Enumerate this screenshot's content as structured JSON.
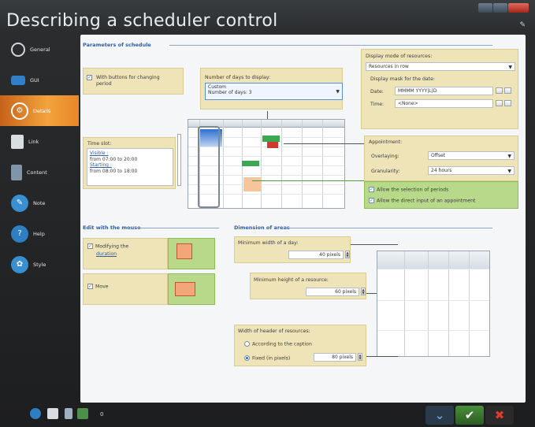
{
  "window": {
    "title": "Describing a scheduler control"
  },
  "sidebar": {
    "items": [
      {
        "label": "General",
        "icon": "circle-icon",
        "active": false
      },
      {
        "label": "GUI",
        "icon": "gui-icon",
        "active": false
      },
      {
        "label": "Details",
        "icon": "details-icon",
        "active": true
      },
      {
        "label": "Link",
        "icon": "link-icon",
        "active": false
      },
      {
        "label": "Content",
        "icon": "content-icon",
        "active": false
      },
      {
        "label": "Note",
        "icon": "note-icon",
        "active": false
      },
      {
        "label": "Help",
        "icon": "help-icon",
        "active": false
      },
      {
        "label": "Style",
        "icon": "style-icon",
        "active": false
      }
    ]
  },
  "params": {
    "section_title": "Parameters of schedule",
    "with_buttons_label": "With buttons for changing period",
    "days_label": "Number of days to display:",
    "days_value_line1": "Custom",
    "days_value_line2": "Number of days: 3",
    "time_slot_label": "Time slot:",
    "visible_label": "Visible :",
    "visible_value": "from 07:00 to 20:00",
    "starting_label": "Starting :",
    "starting_value": "from 08:00 to 18:00"
  },
  "display_mode": {
    "label": "Display mode of resources:",
    "value": "Resources in row",
    "mask_label": "Display mask for the date:",
    "date_label": "Date:",
    "date_value": "MMMM YYYY|L|D",
    "time_label": "Time:",
    "time_value": "<None>"
  },
  "appointment": {
    "label": "Appointment:",
    "overlaying_label": "Overlaying:",
    "overlaying_value": "Offset",
    "granularity_label": "Granularity:",
    "granularity_value": "24 hours",
    "allow_selection": "Allow the selection of periods",
    "allow_direct_input": "Allow the direct input of an appointment"
  },
  "mouse": {
    "section_title": "Edit with the mouse",
    "modify_label": "Modifying the",
    "modify_link": "duration",
    "move_label": "Move"
  },
  "dimension": {
    "section_title": "Dimension of areas",
    "min_width_label": "Minimum width of a day:",
    "min_width_value": "40 pixels",
    "min_height_label": "Minimum height of a resource:",
    "min_height_value": "60 pixels",
    "header_width_label": "Width of header of resources:",
    "opt_caption": "According to the caption",
    "opt_fixed": "Fixed (in pixels)",
    "fixed_value": "80 pixels"
  },
  "bottom": {
    "count": "0"
  },
  "colors": {
    "accent_orange": "#f3a33c",
    "yellow_box": "#efe4b8",
    "green_box": "#b9d98a",
    "section_blue": "#2f5ea0"
  }
}
